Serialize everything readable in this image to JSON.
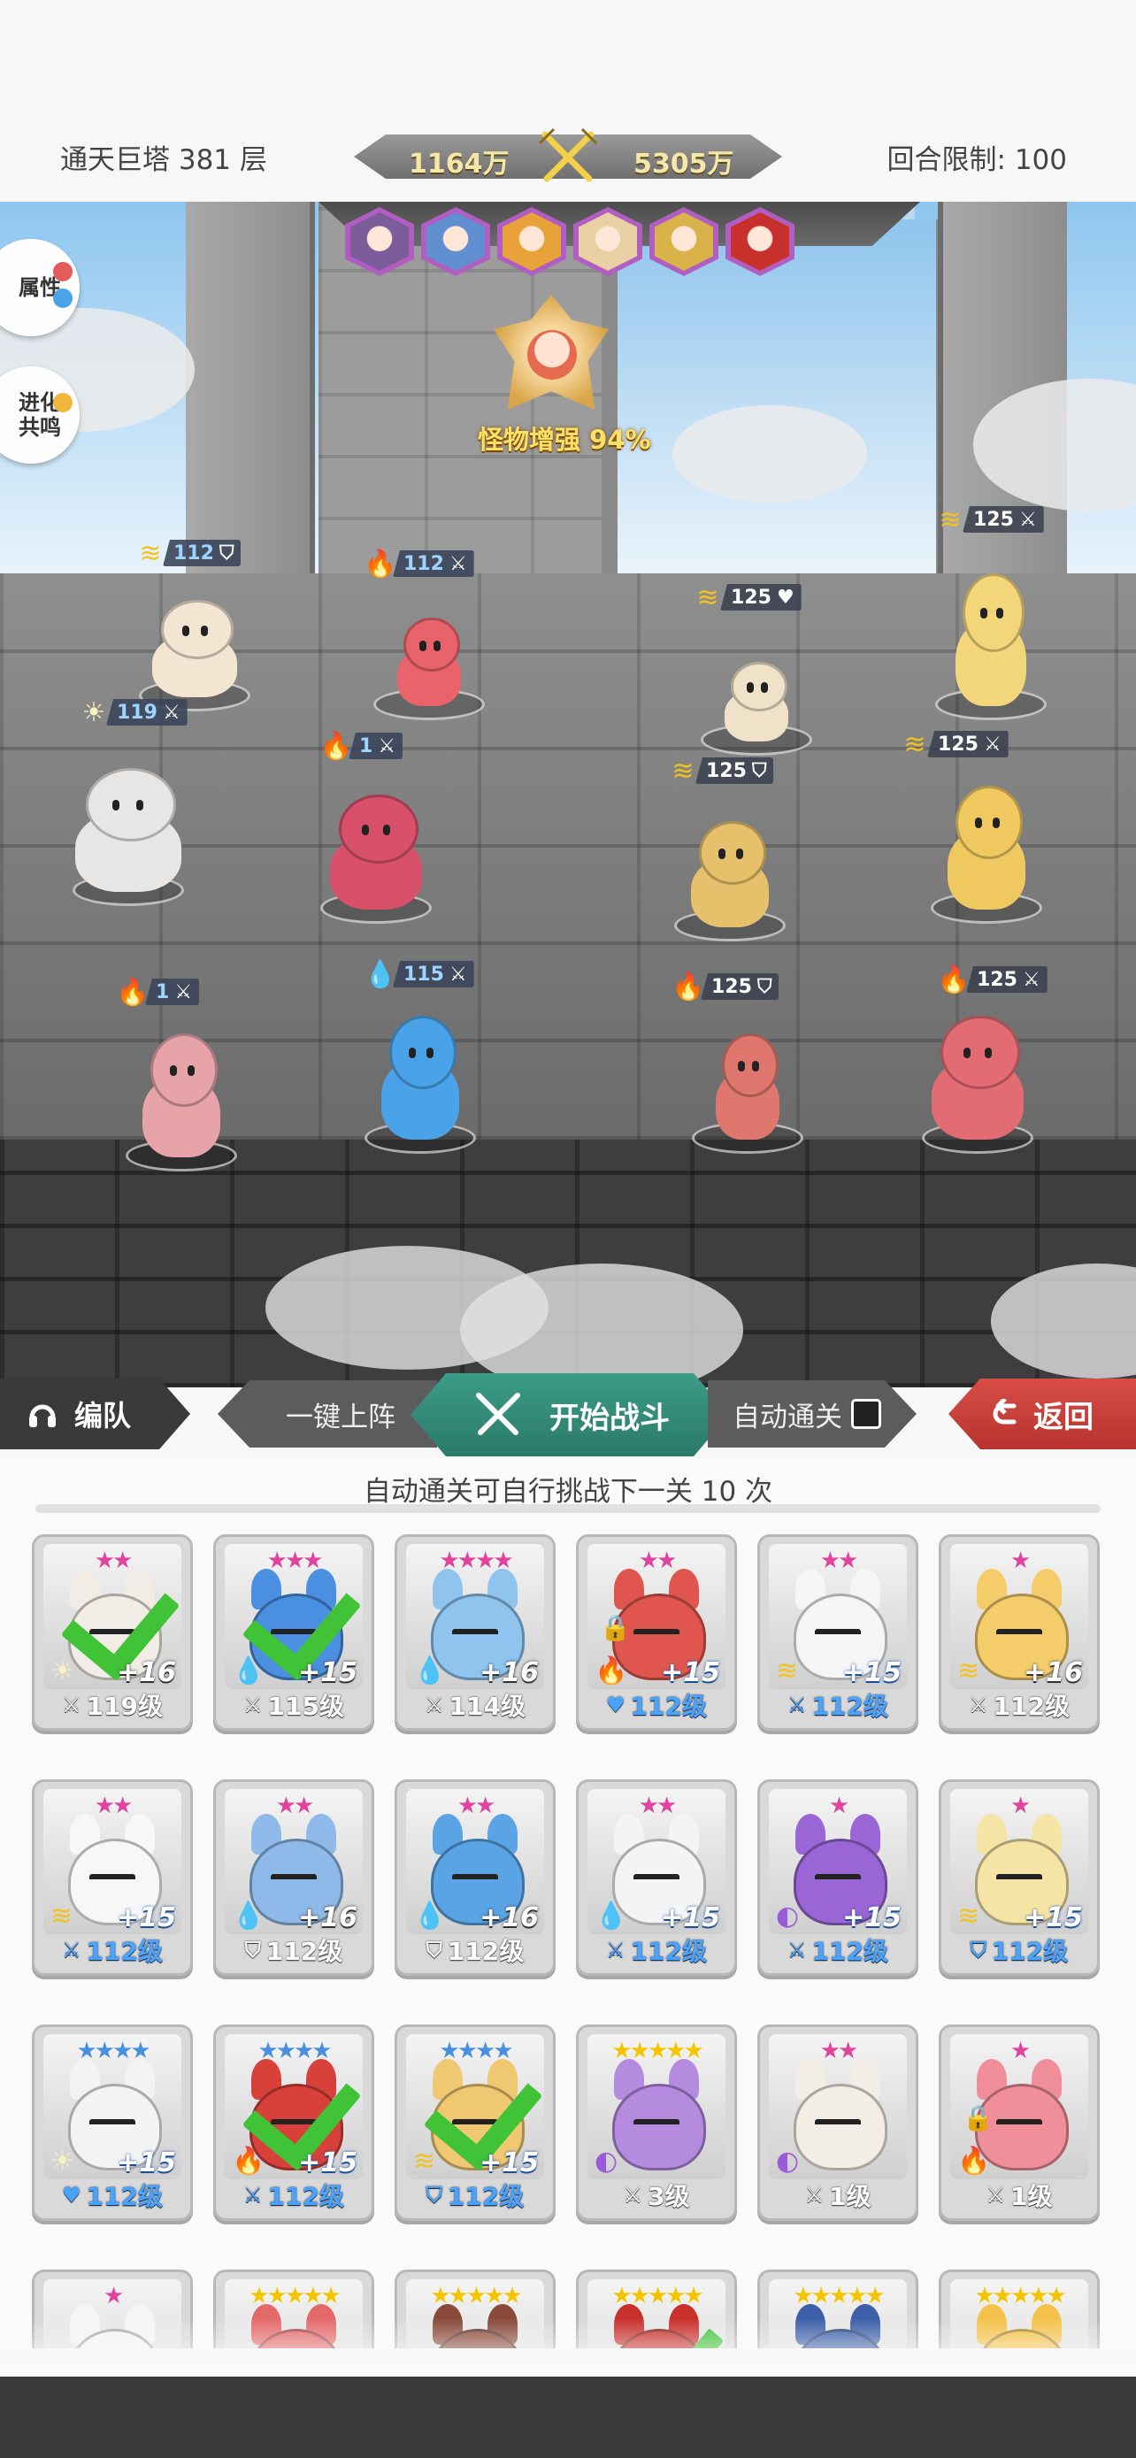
{
  "header": {
    "tower_title": "通天巨塔 381 层",
    "power_ally": "1164万",
    "power_enemy": "5305万",
    "round_limit": "回合限制: 100"
  },
  "side_buttons": {
    "attributes": "属性",
    "evolution": "进化共鸣"
  },
  "boss": {
    "label": "怪物增强 94%"
  },
  "enemy_portraits": [
    "#7d5c9c",
    "#5f8fd1",
    "#e9a23a",
    "#e8cfa4",
    "#d9b24a",
    "#c8302c"
  ],
  "units": [
    {
      "id": "ally-1",
      "element": "thunder",
      "level": "112",
      "role": "shield"
    },
    {
      "id": "ally-2",
      "element": "light",
      "level": "119",
      "role": "sword"
    },
    {
      "id": "ally-3",
      "element": "fire",
      "level": "112",
      "role": "sword"
    },
    {
      "id": "ally-4",
      "element": "fire",
      "level": "1",
      "role": "sword"
    },
    {
      "id": "ally-5",
      "element": "fire",
      "level": "1",
      "role": "sword"
    },
    {
      "id": "ally-6",
      "element": "water",
      "level": "115",
      "role": "sword"
    },
    {
      "id": "enemy-1",
      "element": "thunder",
      "level": "125",
      "role": "heart"
    },
    {
      "id": "enemy-2",
      "element": "thunder",
      "level": "125",
      "role": "shield"
    },
    {
      "id": "enemy-3",
      "element": "fire",
      "level": "125",
      "role": "shield"
    },
    {
      "id": "enemy-4",
      "element": "thunder",
      "level": "125",
      "role": "sword"
    },
    {
      "id": "enemy-5",
      "element": "thunder",
      "level": "125",
      "role": "sword"
    },
    {
      "id": "enemy-6",
      "element": "fire",
      "level": "125",
      "role": "sword"
    }
  ],
  "actions": {
    "team": "编队",
    "one_key": "一键上阵",
    "start_battle": "开始战斗",
    "auto_clear": "自动通关",
    "back": "返回"
  },
  "roster": {
    "note": "自动通关可自行挑战下一关 10 次",
    "cards": [
      {
        "stars": "★★",
        "star_color": "#e0449d",
        "plus": "+16",
        "level": "119级",
        "role": "sword",
        "element": "light",
        "checked": true,
        "locked": false,
        "color": "#f1ede6",
        "blue": false
      },
      {
        "stars": "★★★",
        "star_color": "#e0449d",
        "plus": "+15",
        "level": "115级",
        "role": "sword",
        "element": "water",
        "checked": true,
        "locked": false,
        "color": "#4a8fe0",
        "blue": false
      },
      {
        "stars": "★★★★",
        "star_color": "#e0449d",
        "plus": "+16",
        "level": "114级",
        "role": "sword",
        "element": "water",
        "checked": false,
        "locked": false,
        "color": "#8ec4ee",
        "blue": false
      },
      {
        "stars": "★★",
        "star_color": "#e0449d",
        "plus": "+15",
        "level": "112级",
        "role": "heart",
        "element": "fire",
        "checked": false,
        "locked": true,
        "color": "#e0564f",
        "blue": true
      },
      {
        "stars": "★★",
        "star_color": "#e0449d",
        "plus": "+15",
        "level": "112级",
        "role": "sword",
        "element": "thunder",
        "checked": false,
        "locked": false,
        "color": "#f5f5f5",
        "blue": true
      },
      {
        "stars": "★",
        "star_color": "#e0449d",
        "plus": "+16",
        "level": "112级",
        "role": "sword",
        "element": "thunder",
        "checked": false,
        "locked": false,
        "color": "#f4cc6a",
        "blue": false
      },
      {
        "stars": "★★",
        "star_color": "#e0449d",
        "plus": "+15",
        "level": "112级",
        "role": "sword",
        "element": "thunder",
        "checked": false,
        "locked": false,
        "color": "#f7f7f7",
        "blue": true
      },
      {
        "stars": "★★",
        "star_color": "#e0449d",
        "plus": "+16",
        "level": "112级",
        "role": "shield",
        "element": "water",
        "checked": false,
        "locked": false,
        "color": "#8fb9e8",
        "blue": false
      },
      {
        "stars": "★★",
        "star_color": "#e0449d",
        "plus": "+16",
        "level": "112级",
        "role": "shield",
        "element": "water",
        "checked": false,
        "locked": false,
        "color": "#5aa4e6",
        "blue": false
      },
      {
        "stars": "★★",
        "star_color": "#e0449d",
        "plus": "+15",
        "level": "112级",
        "role": "sword",
        "element": "water",
        "checked": false,
        "locked": false,
        "color": "#f4f4f4",
        "blue": true
      },
      {
        "stars": "★",
        "star_color": "#e0449d",
        "plus": "+15",
        "level": "112级",
        "role": "sword",
        "element": "dark",
        "checked": false,
        "locked": false,
        "color": "#9a66d6",
        "blue": true
      },
      {
        "stars": "★",
        "star_color": "#e0449d",
        "plus": "+15",
        "level": "112级",
        "role": "shield",
        "element": "thunder",
        "checked": false,
        "locked": false,
        "color": "#f6e3a6",
        "blue": true
      },
      {
        "stars": "★★★★",
        "star_color": "#4a8fe0",
        "plus": "+15",
        "level": "112级",
        "role": "heart",
        "element": "light",
        "checked": false,
        "locked": false,
        "color": "#f3f3f3",
        "blue": true
      },
      {
        "stars": "★★★★",
        "star_color": "#4a8fe0",
        "plus": "+15",
        "level": "112级",
        "role": "sword",
        "element": "fire",
        "checked": true,
        "locked": false,
        "color": "#d8403a",
        "blue": true
      },
      {
        "stars": "★★★★",
        "star_color": "#4a8fe0",
        "plus": "+15",
        "level": "112级",
        "role": "shield",
        "element": "thunder",
        "checked": true,
        "locked": false,
        "color": "#f1c872",
        "blue": true
      },
      {
        "stars": "★★★★★",
        "star_color": "#f5c400",
        "plus": "",
        "level": "3级",
        "role": "sword",
        "element": "dark",
        "checked": false,
        "locked": false,
        "color": "#b58be0",
        "blue": false
      },
      {
        "stars": "★★",
        "star_color": "#e0449d",
        "plus": "",
        "level": "1级",
        "role": "sword",
        "element": "dark",
        "checked": false,
        "locked": false,
        "color": "#f2eee6",
        "blue": false
      },
      {
        "stars": "★",
        "star_color": "#e0449d",
        "plus": "",
        "level": "1级",
        "role": "sword",
        "element": "fire",
        "checked": false,
        "locked": true,
        "color": "#f08f9a",
        "blue": false
      },
      {
        "stars": "★",
        "star_color": "#e0449d",
        "plus": "",
        "level": "",
        "role": "",
        "element": "",
        "checked": false,
        "locked": false,
        "color": "#f5f5f5",
        "blue": false
      },
      {
        "stars": "★★★★★",
        "star_color": "#f5c400",
        "plus": "",
        "level": "",
        "role": "",
        "element": "",
        "checked": false,
        "locked": false,
        "color": "#e46a6a",
        "blue": false
      },
      {
        "stars": "★★★★★",
        "star_color": "#f5c400",
        "plus": "",
        "level": "",
        "role": "",
        "element": "",
        "checked": false,
        "locked": false,
        "color": "#8a4a3a",
        "blue": false
      },
      {
        "stars": "★★★★★",
        "star_color": "#f5c400",
        "plus": "",
        "level": "",
        "role": "",
        "element": "",
        "checked": true,
        "locked": false,
        "color": "#c8302c",
        "blue": false
      },
      {
        "stars": "★★★★★",
        "star_color": "#f5c400",
        "plus": "",
        "level": "",
        "role": "",
        "element": "",
        "checked": false,
        "locked": false,
        "color": "#3d5fa8",
        "blue": false
      },
      {
        "stars": "★★★★★",
        "star_color": "#f5c400",
        "plus": "",
        "level": "",
        "role": "",
        "element": "",
        "checked": false,
        "locked": false,
        "color": "#f4c24a",
        "blue": false
      }
    ]
  },
  "icons": {
    "fire": "🔥",
    "water": "💧",
    "thunder": "≋",
    "light": "☀",
    "dark": "◐",
    "sword": "⚔",
    "shield": "⛉",
    "heart": "♥",
    "lock": "🔒"
  }
}
